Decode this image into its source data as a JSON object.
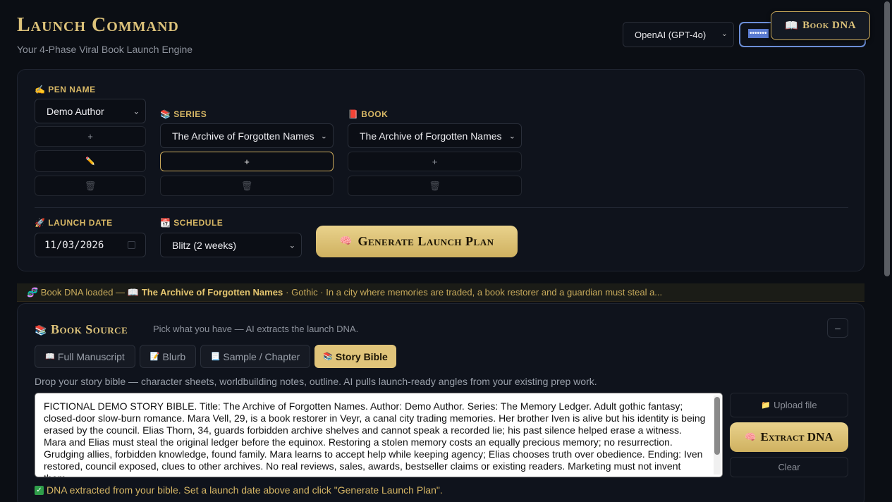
{
  "header": {
    "title": "Launch Command",
    "subtitle": "Your 4-Phase Viral Book Launch Engine",
    "provider": "OpenAI (GPT-4o)",
    "api_key_masked": "•••••••",
    "book_dna_button": "Book DNA",
    "book_dna_icon": "📖"
  },
  "setup": {
    "pen_name_label": "Pen Name",
    "pen_name_icon": "✍",
    "pen_name_value": "Demo Author",
    "series_label": "Series",
    "series_icon": "📚",
    "series_value": "The Archive of Forgotten Names",
    "book_label": "Book",
    "book_icon": "📕",
    "book_value": "The Archive of Forgotten Names",
    "add_glyph": "+",
    "edit_glyph": "✏️",
    "delete_glyph": "🗑",
    "launch_date_label": "Launch Date",
    "launch_date_icon": "🚀",
    "launch_date_value": "11/03/2026",
    "schedule_label": "Schedule",
    "schedule_icon": "📆",
    "schedule_value": "Blitz (2 weeks)",
    "generate_button": "Generate Launch Plan",
    "generate_icon": "🧠"
  },
  "banner": {
    "prefix": "🧬 Book DNA loaded — 📖",
    "book_title": "The Archive of Forgotten Names",
    "details": "· Gothic · In a city where memories are traded, a book restorer and a guardian must steal a..."
  },
  "source": {
    "title": "Book Source",
    "icon": "📚",
    "subtitle": "Pick what you have — AI extracts the launch DNA.",
    "collapse": "–",
    "tabs": [
      {
        "icon": "📖",
        "label": "Full Manuscript"
      },
      {
        "icon": "📝",
        "label": "Blurb"
      },
      {
        "icon": "📃",
        "label": "Sample / Chapter"
      },
      {
        "icon": "📚",
        "label": "Story Bible"
      }
    ],
    "active_tab": "Story Bible",
    "hint": "Drop your story bible — character sheets, worldbuilding notes, outline. AI pulls launch-ready angles from your existing prep work.",
    "text": "FICTIONAL DEMO STORY BIBLE. Title: The Archive of Forgotten Names. Author: Demo Author. Series: The Memory Ledger. Adult gothic fantasy; closed-door slow-burn romance. Mara Vell, 29, is a book restorer in Veyr, a canal city trading memories. Her brother Iven is alive but his identity is being erased by the council. Elias Thorn, 34, guards forbidden archive shelves and cannot speak a recorded lie; his past silence helped erase a witness. Mara and Elias must steal the original ledger before the equinox. Restoring a stolen memory costs an equally precious memory; no resurrection. Grudging allies, forbidden knowledge, found family. Mara learns to accept help while keeping agency; Elias chooses truth over obedience. Ending: Iven restored, council exposed, clues to other archives. No real reviews, sales, awards, bestseller claims or existing readers. Marketing must not invent them.",
    "upload_icon": "📁",
    "upload_label": "Upload file",
    "extract_icon": "🧠",
    "extract_label": "Extract DNA",
    "clear_label": "Clear",
    "status": "DNA extracted from your bible. Set a launch date above and click \"Generate Launch Plan\"."
  },
  "colors": {
    "accent_gold": "#dcc27a",
    "background": "#0b0e14",
    "panel": "#0f131c"
  }
}
